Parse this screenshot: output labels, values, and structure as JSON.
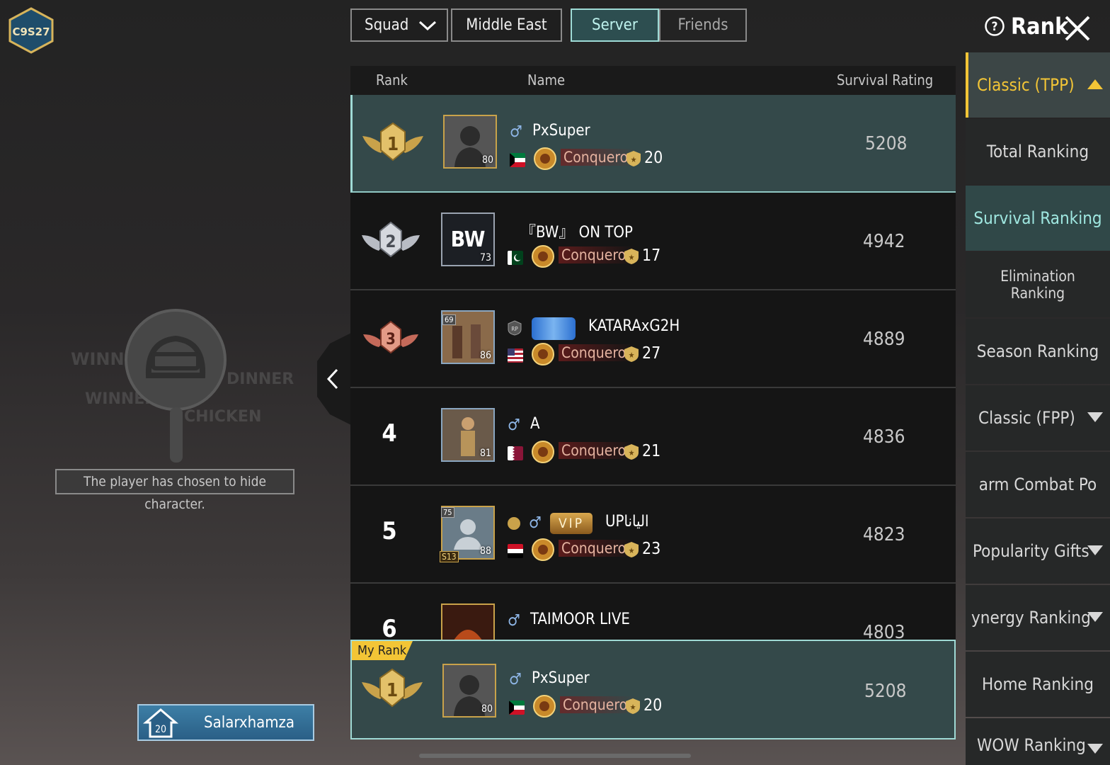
{
  "season_badge": "C9S27",
  "filters": {
    "mode": "Squad",
    "region": "Middle East",
    "server": "Server",
    "friends": "Friends"
  },
  "header": {
    "title": "Rank"
  },
  "table": {
    "columns": {
      "rank": "Rank",
      "name": "Name",
      "rating": "Survival Rating"
    },
    "rows": [
      {
        "rank": "1",
        "name": "PxSuper",
        "level": "80",
        "tier": "Conqueror",
        "stars": "20",
        "rating": "5208",
        "flag": "kuwait"
      },
      {
        "rank": "2",
        "name": "『BW』 ON TOP",
        "level": "73",
        "tier": "Conqueror",
        "stars": "17",
        "rating": "4942",
        "flag": "pakistan",
        "avatar_text": "BW"
      },
      {
        "rank": "3",
        "name": "KATARAxG2H",
        "level": "86",
        "badge_level": "69",
        "rp": "RP",
        "tier": "Conqueror",
        "stars": "27",
        "rating": "4889",
        "flag": "usa"
      },
      {
        "rank": "4",
        "name": "A",
        "level": "81",
        "tier": "Conqueror",
        "stars": "21",
        "rating": "4836",
        "flag": "qatar"
      },
      {
        "rank": "5",
        "name": "UPاليانا",
        "level": "88",
        "badge_level": "75",
        "season_tag": "S13",
        "vip": "VIP",
        "tier": "Conqueror",
        "stars": "23",
        "rating": "4823",
        "flag": "iraq"
      },
      {
        "rank": "6",
        "name": "TAIMOOR LIVE",
        "rating": "4803"
      }
    ]
  },
  "my_rank": {
    "label": "My Rank",
    "name": "PxSuper",
    "level": "80",
    "tier": "Conqueror",
    "stars": "20",
    "rating": "5208"
  },
  "sidebar": {
    "items": [
      {
        "label": "Classic (TPP)"
      },
      {
        "label": "Total Ranking"
      },
      {
        "label": "Survival Ranking"
      },
      {
        "label": "Elimination Ranking"
      },
      {
        "label": "Season Ranking"
      },
      {
        "label": "Classic (FPP)"
      },
      {
        "label": "arm Combat Po"
      },
      {
        "label": "Popularity Gifts"
      },
      {
        "label": "ynergy Ranking"
      },
      {
        "label": "Home Ranking"
      },
      {
        "label": "WOW Ranking"
      }
    ]
  },
  "left_panel": {
    "hidden_text": "The player has chosen to hide character.",
    "crew_level": "20",
    "crew_name": "Salarxhamza"
  },
  "colors": {
    "accent_teal": "#9fdad5",
    "accent_gold": "#f3c536",
    "selected_row": "#34494a"
  }
}
